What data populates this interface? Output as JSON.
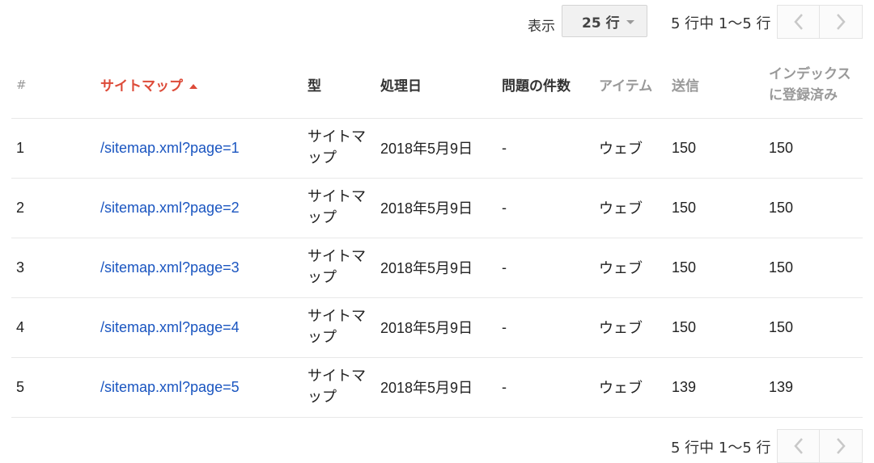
{
  "pagination": {
    "show_label": "表示",
    "rows_per_page": "25 行",
    "range": "5 行中 1〜5 行",
    "prev_label": "前のページ",
    "next_label": "次のページ"
  },
  "table": {
    "headers": {
      "num": "#",
      "sitemap": "サイトマップ",
      "type": "型",
      "processed": "処理日",
      "issues": "問題の件数",
      "items": "アイテム",
      "submitted": "送信",
      "indexed": "インデックスに登録済み"
    },
    "rows": [
      {
        "num": "1",
        "sitemap": "/sitemap.xml?page=1",
        "type": "サイトマップ",
        "processed": "2018年5月9日",
        "issues": "-",
        "items": "ウェブ",
        "submitted": "150",
        "indexed": "150"
      },
      {
        "num": "2",
        "sitemap": "/sitemap.xml?page=2",
        "type": "サイトマップ",
        "processed": "2018年5月9日",
        "issues": "-",
        "items": "ウェブ",
        "submitted": "150",
        "indexed": "150"
      },
      {
        "num": "3",
        "sitemap": "/sitemap.xml?page=3",
        "type": "サイトマップ",
        "processed": "2018年5月9日",
        "issues": "-",
        "items": "ウェブ",
        "submitted": "150",
        "indexed": "150"
      },
      {
        "num": "4",
        "sitemap": "/sitemap.xml?page=4",
        "type": "サイトマップ",
        "processed": "2018年5月9日",
        "issues": "-",
        "items": "ウェブ",
        "submitted": "150",
        "indexed": "150"
      },
      {
        "num": "5",
        "sitemap": "/sitemap.xml?page=5",
        "type": "サイトマップ",
        "processed": "2018年5月9日",
        "issues": "-",
        "items": "ウェブ",
        "submitted": "139",
        "indexed": "139"
      }
    ]
  },
  "colors": {
    "link": "#1a55c0",
    "sorted_header": "#dd4b39",
    "muted_header": "#999999"
  },
  "icons": {
    "prev": "chevron-left-icon",
    "next": "chevron-right-icon",
    "sort": "sort-ascending-icon",
    "dropdown": "caret-down-icon"
  }
}
